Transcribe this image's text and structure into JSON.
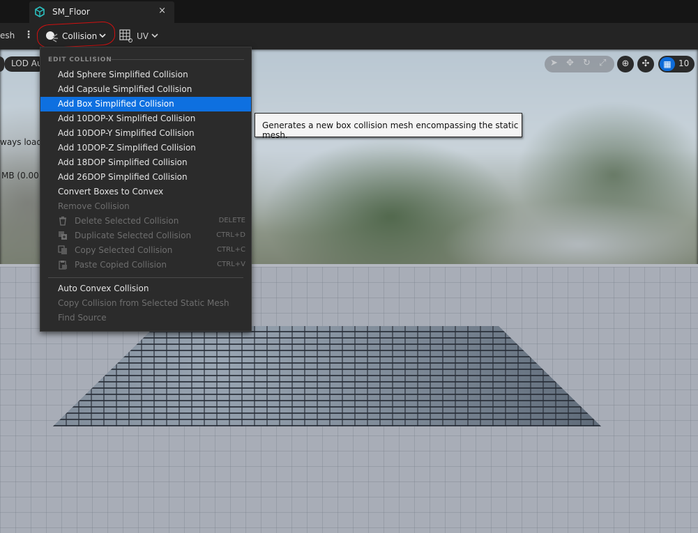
{
  "tab": {
    "title": "SM_Floor",
    "close": "×"
  },
  "toolbar": {
    "mesh_label_partial": "esh",
    "more": "⋮",
    "collision_label": "Collision",
    "uv_label": "UV",
    "chevron": "⌄"
  },
  "viewport": {
    "lod_label_partial": "LOD Au",
    "info_line_1_partial": "ways load",
    "info_line_2_partial": "MB (0.00 I",
    "grid_snap_value": "10"
  },
  "menu": {
    "section_title": "EDIT COLLISION",
    "items": [
      {
        "label": "Add Sphere Simplified Collision",
        "enabled": true
      },
      {
        "label": "Add Capsule Simplified Collision",
        "enabled": true
      },
      {
        "label": "Add Box Simplified Collision",
        "enabled": true,
        "selected": true
      },
      {
        "label": "Add 10DOP-X Simplified Collision",
        "enabled": true
      },
      {
        "label": "Add 10DOP-Y Simplified Collision",
        "enabled": true
      },
      {
        "label": "Add 10DOP-Z Simplified Collision",
        "enabled": true
      },
      {
        "label": "Add 18DOP Simplified Collision",
        "enabled": true
      },
      {
        "label": "Add 26DOP Simplified Collision",
        "enabled": true
      },
      {
        "label": "Convert Boxes to Convex",
        "enabled": true
      },
      {
        "label": "Remove Collision",
        "enabled": false
      },
      {
        "label": "Delete Selected Collision",
        "enabled": false,
        "shortcut": "DELETE",
        "icon": "trash-icon"
      },
      {
        "label": "Duplicate Selected Collision",
        "enabled": false,
        "shortcut": "CTRL+D",
        "icon": "duplicate-icon"
      },
      {
        "label": "Copy Selected Collision",
        "enabled": false,
        "shortcut": "CTRL+C",
        "icon": "copy-icon"
      },
      {
        "label": "Paste Copied Collision",
        "enabled": false,
        "shortcut": "CTRL+V",
        "icon": "paste-icon"
      },
      {
        "label": "Auto Convex Collision",
        "enabled": true
      },
      {
        "label": "Copy Collision from Selected Static Mesh",
        "enabled": false
      },
      {
        "label": "Find Source",
        "enabled": false
      }
    ]
  },
  "tooltip": {
    "text": "Generates a new box collision mesh encompassing the static mesh."
  },
  "colors": {
    "accent": "#0e70e0",
    "annotation": "#d21010"
  }
}
